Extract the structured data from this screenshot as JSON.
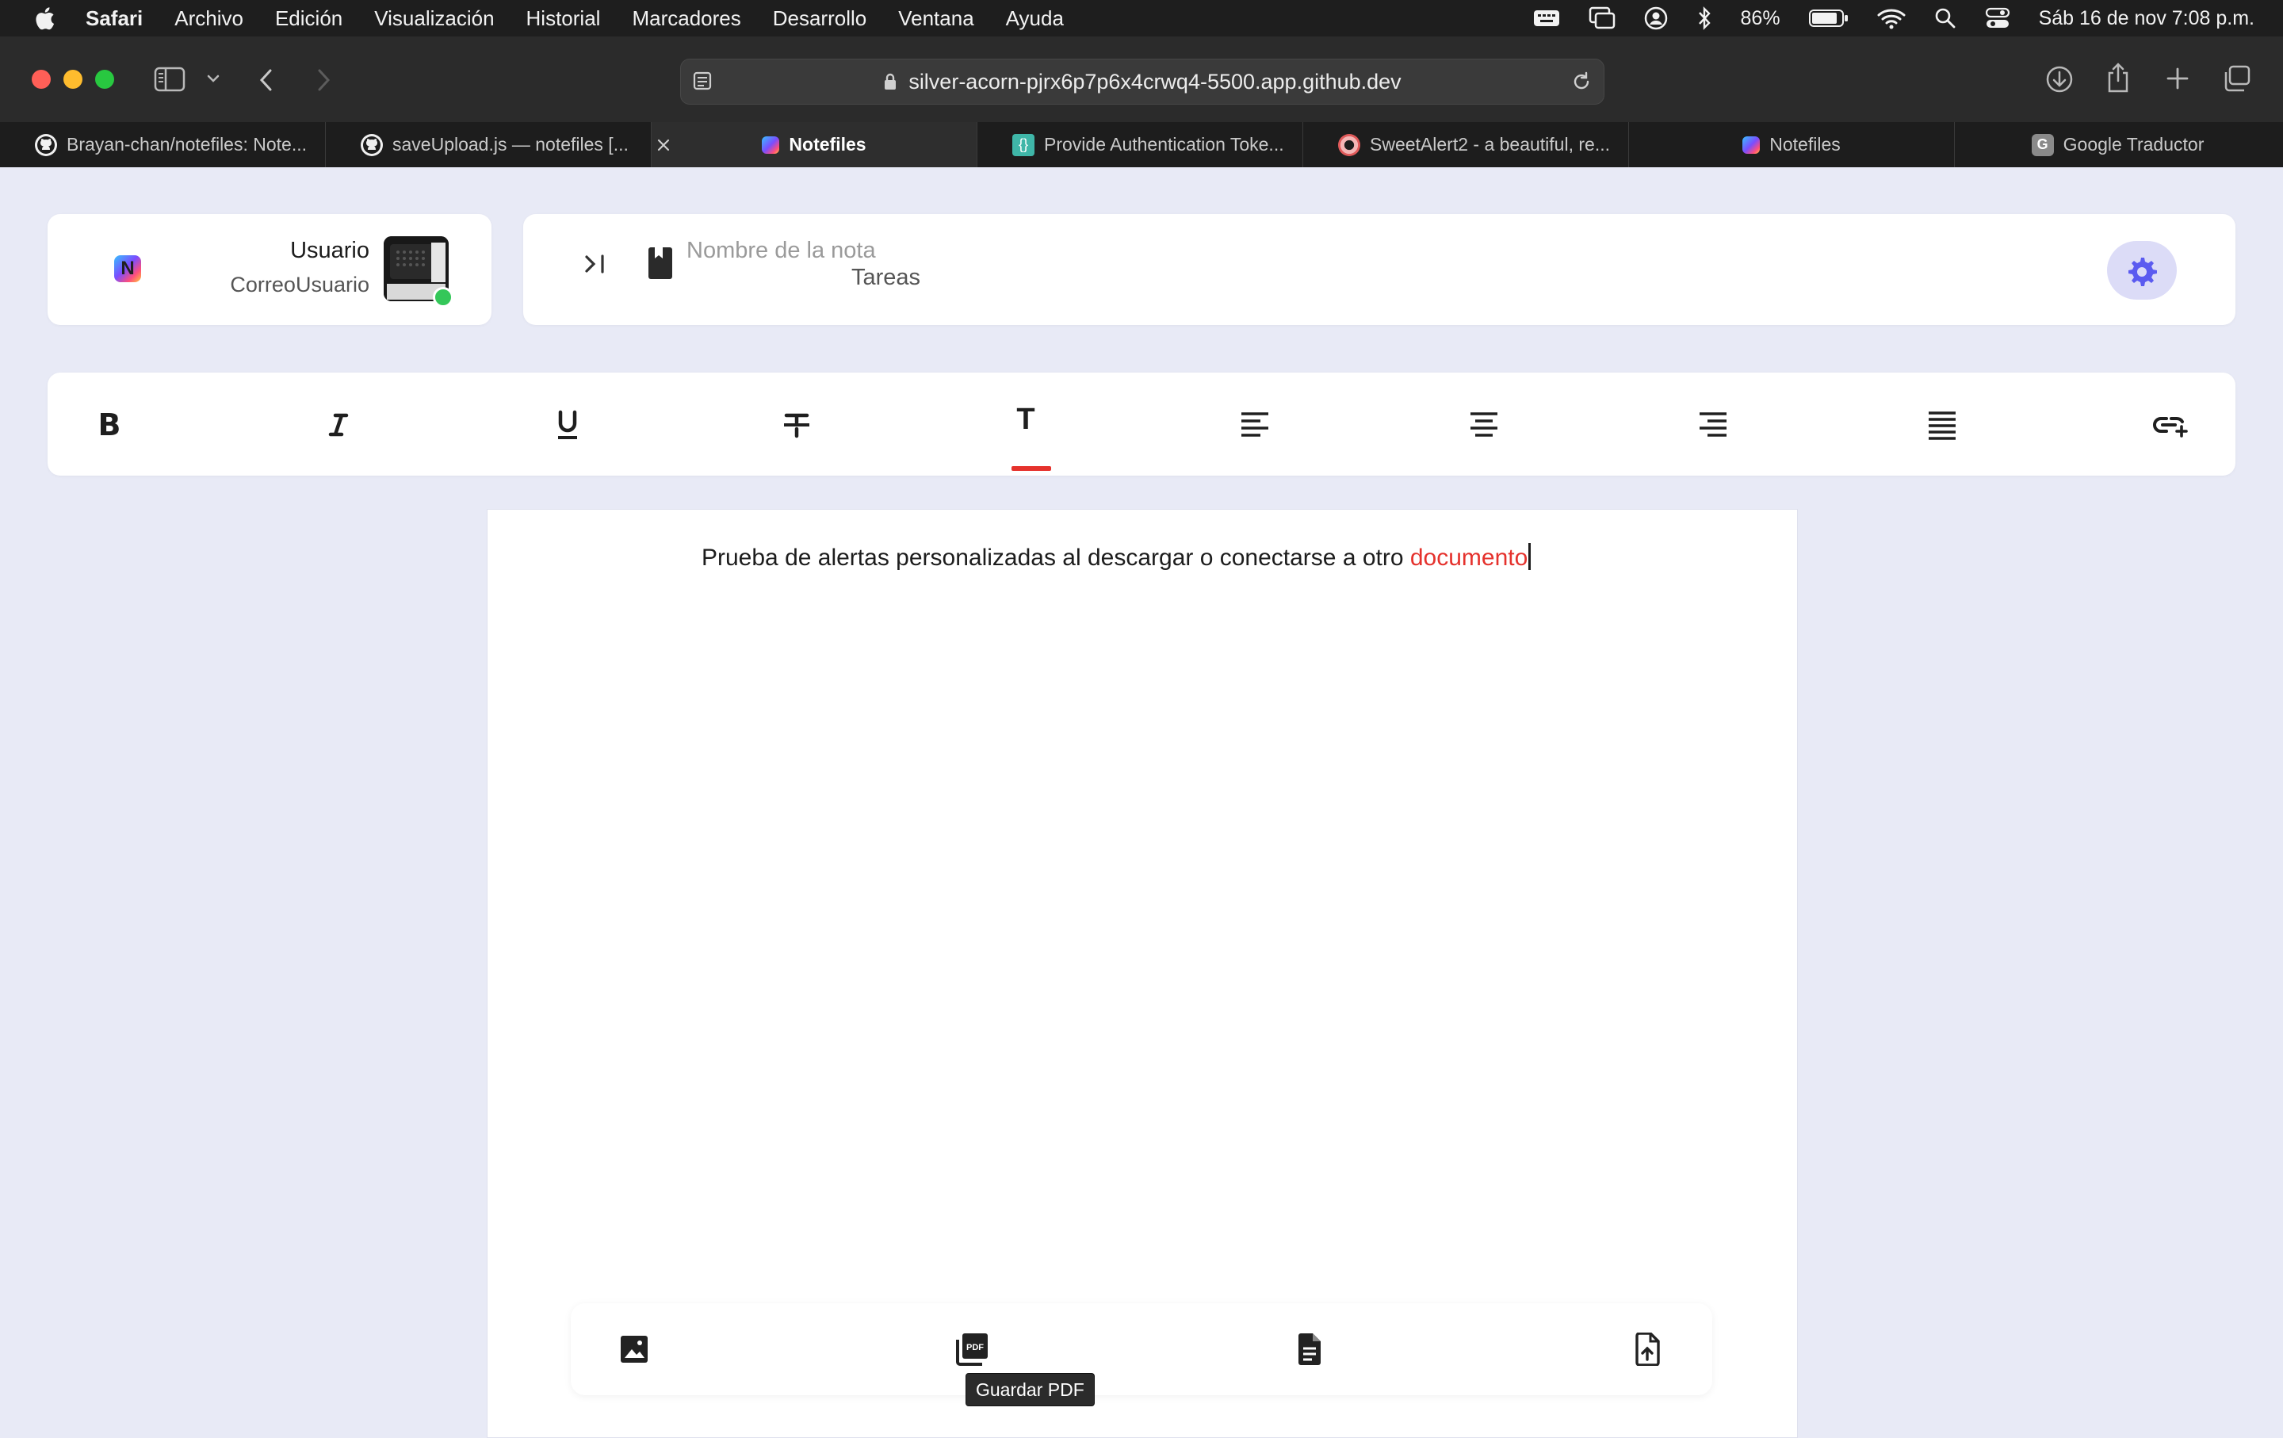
{
  "menubar": {
    "app_name": "Safari",
    "items": [
      "Archivo",
      "Edición",
      "Visualización",
      "Historial",
      "Marcadores",
      "Desarrollo",
      "Ventana",
      "Ayuda"
    ],
    "battery_percent": "86%",
    "datetime": "Sáb 16 de nov  7:08 p.m."
  },
  "browser": {
    "url": "silver-acorn-pjrx6p7p6x4crwq4-5500.app.github.dev",
    "tabs": [
      {
        "label": "Brayan-chan/notefiles: Note...",
        "icon": "github-icon"
      },
      {
        "label": "saveUpload.js — notefiles [...",
        "icon": "github-icon"
      },
      {
        "label": "Notefiles",
        "icon": "notefiles-icon",
        "active": true
      },
      {
        "label": "Provide Authentication Toke...",
        "icon": "braces-icon"
      },
      {
        "label": "SweetAlert2 - a beautiful, re...",
        "icon": "sweetalert-icon"
      },
      {
        "label": "Notefiles",
        "icon": "notefiles-icon"
      },
      {
        "label": "Google Traductor",
        "icon": "google-g-icon"
      }
    ]
  },
  "user": {
    "name": "Usuario",
    "email": "CorreoUsuario",
    "logo_letter": "N",
    "online_color": "#34c759"
  },
  "note": {
    "name_placeholder": "Nombre de la nota",
    "name_value": "Tareas"
  },
  "format_toolbar": {
    "buttons": [
      "bold",
      "italic",
      "underline",
      "strikethrough",
      "text-color",
      "align-left",
      "align-center",
      "align-right",
      "align-justify",
      "insert-link"
    ],
    "bold_glyph": "B",
    "text_color_glyph": "T",
    "active_color": "#e5322d"
  },
  "editor": {
    "text_plain": "Prueba de alertas personalizadas al descargar o conectarse a otro ",
    "text_highlight": "documento",
    "highlight_color": "#e5322d"
  },
  "bottom_actions": {
    "buttons": [
      "insert-image",
      "save-pdf",
      "save-document",
      "upload-file"
    ],
    "tooltip": "Guardar PDF"
  },
  "colors": {
    "page_bg": "#e8eaf6",
    "accent": "#6366f1"
  }
}
